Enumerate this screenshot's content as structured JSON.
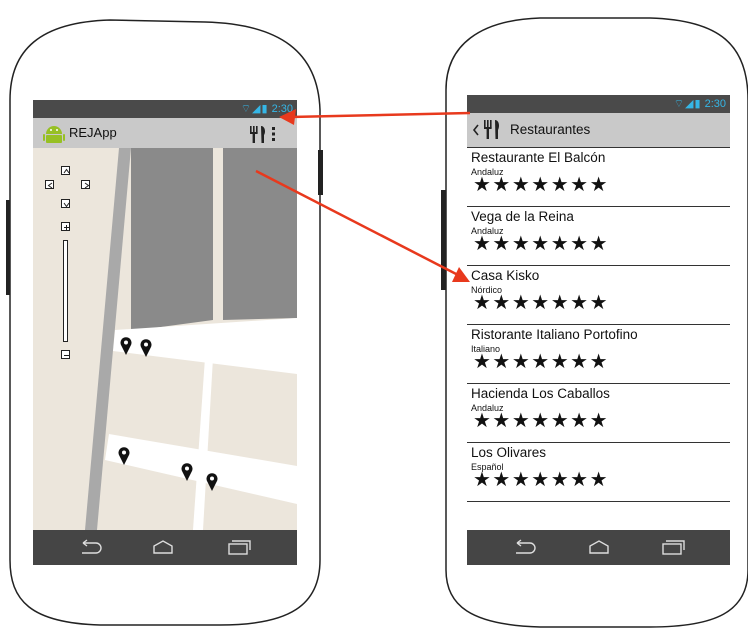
{
  "colors": {
    "status_bar": "#4a4a4a",
    "status_icons": "#35b6e6",
    "action_bar": "#c9c9c9",
    "nav_bar": "#454545",
    "map_blocks": "#8a8a8a",
    "map_background": "#ece6dc",
    "map_streets": "#ffffff",
    "arrow": "#e8391d"
  },
  "phone_left": {
    "status_bar": {
      "time": "2:30"
    },
    "action_bar": {
      "app_icon": "android-icon",
      "title": "REJApp",
      "action_icon": "restaurant-icon",
      "menu_icon": "overflow-menu-icon"
    },
    "map": {
      "controls": [
        "pan-up-icon",
        "pan-left-icon",
        "pan-right-icon",
        "pan-down-icon",
        "zoom-in-icon",
        "zoom-slider",
        "zoom-out-icon"
      ],
      "marker_count": 5
    },
    "nav_bar": [
      "back-icon",
      "home-icon",
      "recents-icon"
    ]
  },
  "phone_right": {
    "status_bar": {
      "time": "2:30"
    },
    "action_bar": {
      "back_icon": "chevron-left-icon",
      "icon": "restaurant-icon",
      "title": "Restaurantes"
    },
    "restaurants": [
      {
        "name": "Restaurante El Balcón",
        "cuisine": "Andaluz",
        "stars": "★★★★★★★",
        "rating": 7
      },
      {
        "name": "Vega de la Reina",
        "cuisine": "Andaluz",
        "stars": "★★★★★★★",
        "rating": 7
      },
      {
        "name": "Casa Kisko",
        "cuisine": "Nórdico",
        "stars": "★★★★★★★",
        "rating": 7
      },
      {
        "name": "Ristorante Italiano Portofino",
        "cuisine": "Italiano",
        "stars": "★★★★★★★",
        "rating": 7
      },
      {
        "name": "Hacienda Los Caballos",
        "cuisine": "Andaluz",
        "stars": "★★★★★★★",
        "rating": 7
      },
      {
        "name": "Los Olivares",
        "cuisine": "Español",
        "stars": "★★★★★★★",
        "rating": 7
      }
    ],
    "nav_bar": [
      "back-icon",
      "home-icon",
      "recents-icon"
    ]
  },
  "connectors": [
    {
      "from": "restaurant-list-status-bar",
      "to": "map-status-clock"
    },
    {
      "from": "map-area",
      "to": "list-item-casa-kisko"
    }
  ]
}
